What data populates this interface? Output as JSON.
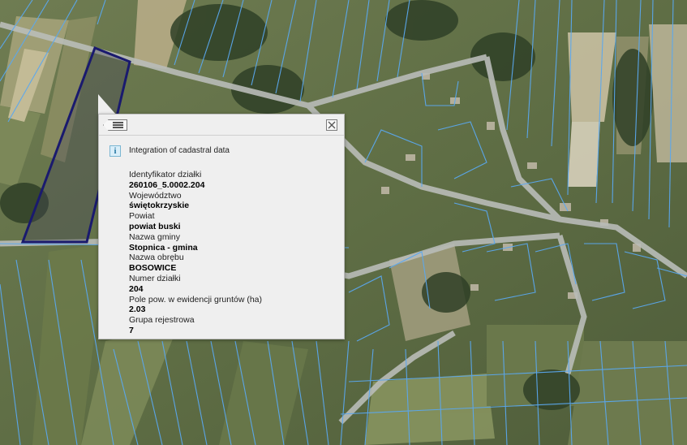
{
  "popup": {
    "layer_title": "Integration of cadastral data",
    "list_icon": "list-back-icon",
    "close_icon": "close-icon",
    "info_icon": "info-icon",
    "info_glyph": "i",
    "fields": [
      {
        "label": "Identyfikator działki",
        "value": "260106_5.0002.204"
      },
      {
        "label": "Województwo",
        "value": "świętokrzyskie"
      },
      {
        "label": "Powiat",
        "value": "powiat buski"
      },
      {
        "label": "Nazwa gminy",
        "value": "Stopnica - gmina"
      },
      {
        "label": "Nazwa obrębu",
        "value": "BOSOWICE"
      },
      {
        "label": "Numer działki",
        "value": "204"
      },
      {
        "label": "Pole pow. w ewidencji gruntów (ha)",
        "value": "2.03"
      },
      {
        "label": "Grupa rejestrowa",
        "value": "7"
      }
    ]
  },
  "map": {
    "parcel_line_color": "#5aa8f0",
    "selected_parcel_color": "#1a1a6e",
    "road_color": "#b9bcb8"
  }
}
